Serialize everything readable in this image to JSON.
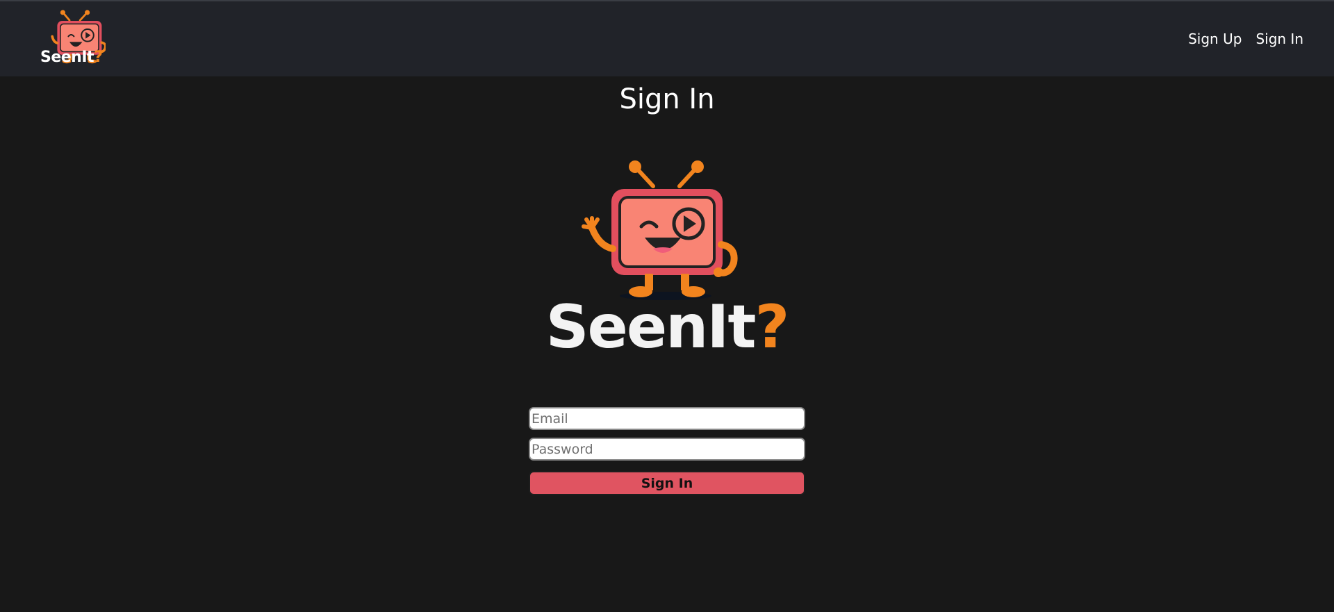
{
  "header": {
    "brand_main": "SeenIt",
    "brand_accent": "?",
    "nav_links": [
      {
        "label": "Sign Up"
      },
      {
        "label": "Sign In"
      }
    ]
  },
  "page": {
    "title": "Sign In"
  },
  "hero": {
    "brand_main": "SeenIt",
    "brand_accent": "?",
    "mascot_icon": "tv-mascot-icon"
  },
  "form": {
    "email_placeholder": "Email",
    "password_placeholder": "Password",
    "submit_label": "Sign In"
  },
  "colors": {
    "background": "#181818",
    "header_background": "#212329",
    "accent_orange": "#f2841e",
    "button_red": "#e05461",
    "tv_body": "#e24f5e",
    "tv_screen": "#f98474"
  }
}
